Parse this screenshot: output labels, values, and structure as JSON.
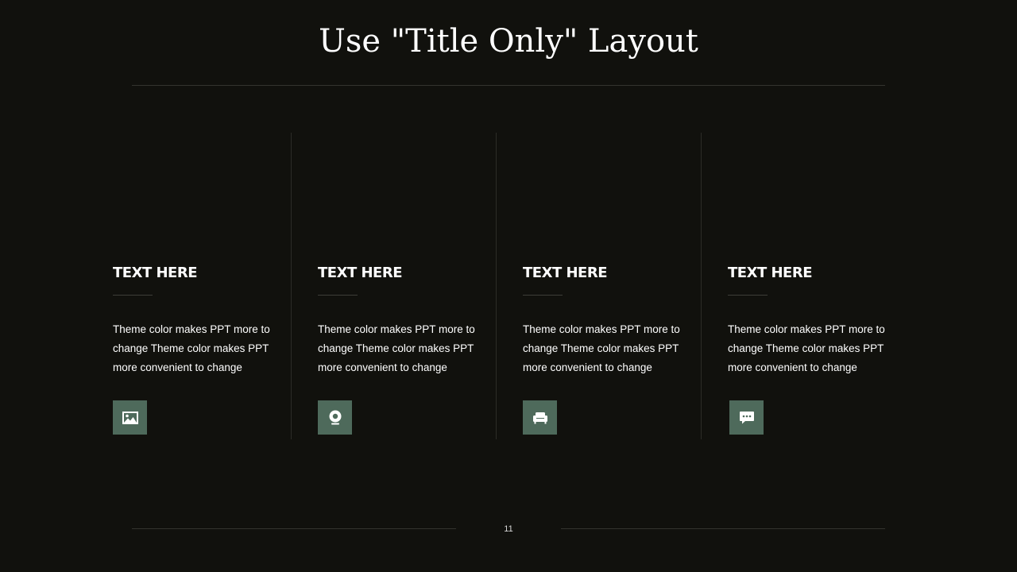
{
  "slide": {
    "title": "Use \"Title Only\" Layout",
    "page_number": "11"
  },
  "cards": [
    {
      "heading": "TEXT HERE",
      "body": "Theme  color makes PPT more to\nchange Theme  color makes PPT\nmore convenient  to change",
      "icon": "image-icon"
    },
    {
      "heading": "TEXT HERE",
      "body": "Theme  color makes PPT more to\nchange Theme  color makes PPT\nmore convenient  to change",
      "icon": "webcam-icon"
    },
    {
      "heading": "TEXT HERE",
      "body": "Theme  color makes PPT more to\nchange Theme  color makes PPT\nmore convenient  to change",
      "icon": "armchair-icon"
    },
    {
      "heading": "TEXT HERE",
      "body": "Theme  color makes PPT more to\nchange Theme  color makes PPT\nmore convenient  to change",
      "icon": "chat-bubble-icon"
    }
  ],
  "colors": {
    "background": "#11110d",
    "accent": "#4e6a5b",
    "divider": "#34342e",
    "text": "#ffffff"
  }
}
